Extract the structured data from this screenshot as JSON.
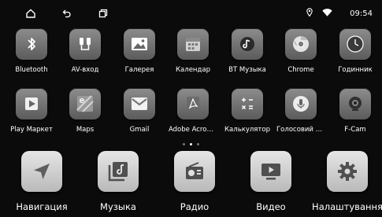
{
  "statusbar": {
    "time": "09:54",
    "icons": [
      "home-icon",
      "back-icon",
      "recent-apps-icon",
      "location-icon",
      "wifi-icon"
    ]
  },
  "apps": [
    {
      "label": "Bluetooth",
      "icon": "bluetooth-icon"
    },
    {
      "label": "AV-вход",
      "icon": "av-input-icon"
    },
    {
      "label": "Галерея",
      "icon": "gallery-icon"
    },
    {
      "label": "Календар",
      "icon": "calendar-icon"
    },
    {
      "label": "BT Музыка",
      "icon": "bt-music-icon"
    },
    {
      "label": "Chrome",
      "icon": "chrome-icon"
    },
    {
      "label": "Годинник",
      "icon": "clock-icon"
    },
    {
      "label": "Play Маркет",
      "icon": "play-store-icon"
    },
    {
      "label": "Maps",
      "icon": "maps-icon"
    },
    {
      "label": "Gmail",
      "icon": "gmail-icon"
    },
    {
      "label": "Adobe Acrobat",
      "icon": "adobe-acrobat-icon"
    },
    {
      "label": "Калькулятор",
      "icon": "calculator-icon"
    },
    {
      "label": "Голосовий пошук",
      "icon": "voice-search-icon"
    },
    {
      "label": "F-Cam",
      "icon": "camera-icon"
    }
  ],
  "pager": {
    "current": 2,
    "total": 3
  },
  "dock": [
    {
      "label": "Навигация",
      "icon": "navigation-icon"
    },
    {
      "label": "Музыка",
      "icon": "music-icon"
    },
    {
      "label": "Радио",
      "icon": "radio-icon"
    },
    {
      "label": "Видео",
      "icon": "video-icon"
    },
    {
      "label": "Налаштування",
      "icon": "settings-icon"
    }
  ]
}
